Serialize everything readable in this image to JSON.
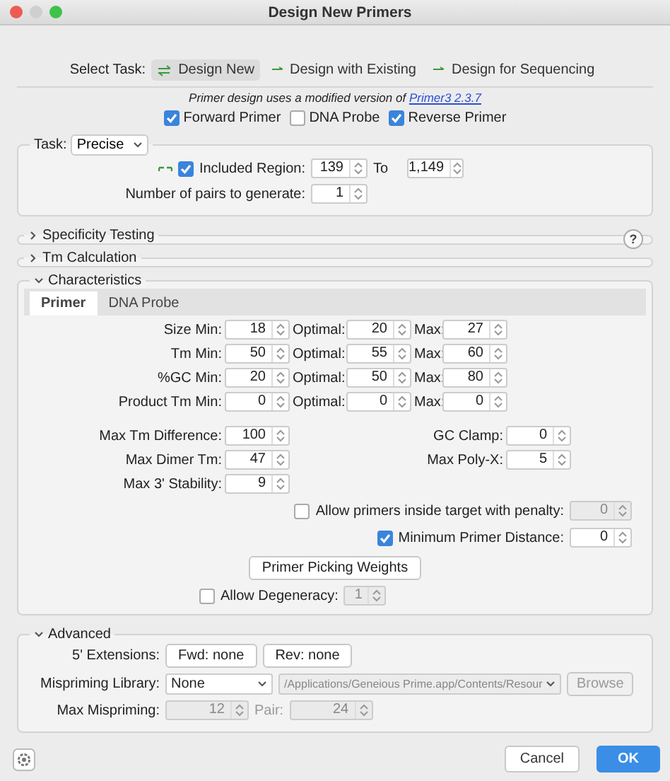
{
  "window": {
    "title": "Design New Primers"
  },
  "select_task": {
    "label": "Select Task:",
    "options": [
      {
        "label": "Design New",
        "selected": true
      },
      {
        "label": "Design with Existing",
        "selected": false
      },
      {
        "label": "Design for Sequencing",
        "selected": false
      }
    ]
  },
  "note": {
    "text": "Primer design uses a modified version of ",
    "link": "Primer3 2.3.7"
  },
  "primer_types": [
    {
      "label": "Forward Primer",
      "checked": true
    },
    {
      "label": "DNA Probe",
      "checked": false
    },
    {
      "label": "Reverse Primer",
      "checked": true
    }
  ],
  "task": {
    "label": "Task:",
    "value": "Precise",
    "included_region": {
      "checked": true,
      "label": "Included Region:",
      "from": "139",
      "to_label": "To",
      "to": "1,149"
    },
    "pairs": {
      "label": "Number of pairs to generate:",
      "value": "1"
    }
  },
  "collapsed_sections": [
    {
      "title": "Specificity Testing",
      "expanded": false,
      "help": "?"
    },
    {
      "title": "Tm Calculation",
      "expanded": false
    }
  ],
  "characteristics": {
    "title": "Characteristics",
    "expanded": true,
    "tabs": [
      {
        "label": "Primer",
        "selected": true
      },
      {
        "label": "DNA Probe",
        "selected": false
      }
    ],
    "ranges": [
      {
        "label": "Size Min:",
        "min": "18",
        "optimal_label": "Optimal:",
        "optimal": "20",
        "max_label": "Max:",
        "max": "27"
      },
      {
        "label": "Tm Min:",
        "min": "50",
        "optimal_label": "Optimal:",
        "optimal": "55",
        "max_label": "Max:",
        "max": "60"
      },
      {
        "label": "%GC Min:",
        "min": "20",
        "optimal_label": "Optimal:",
        "optimal": "50",
        "max_label": "Max:",
        "max": "80"
      },
      {
        "label": "Product Tm Min:",
        "min": "0",
        "optimal_label": "Optimal:",
        "optimal": "0",
        "max_label": "Max:",
        "max": "0"
      }
    ],
    "left_fields": [
      {
        "label": "Max Tm Difference:",
        "value": "100"
      },
      {
        "label": "Max Dimer Tm:",
        "value": "47"
      },
      {
        "label": "Max 3' Stability:",
        "value": "9"
      }
    ],
    "right_fields": [
      {
        "label": "GC Clamp:",
        "value": "0"
      },
      {
        "label": "Max Poly-X:",
        "value": "5"
      }
    ],
    "options": [
      {
        "label": "Allow primers inside target with penalty:",
        "checked": false,
        "value": "0",
        "disabled": true
      },
      {
        "label": "Minimum Primer Distance:",
        "checked": true,
        "value": "0",
        "disabled": false
      }
    ],
    "weights_button": "Primer Picking Weights",
    "degeneracy": {
      "label": "Allow Degeneracy:",
      "checked": false,
      "value": "1",
      "disabled": true
    }
  },
  "advanced": {
    "title": "Advanced",
    "expanded": true,
    "extensions": {
      "label": "5' Extensions:",
      "buttons": [
        "Fwd: none",
        "Rev: none"
      ]
    },
    "mispriming": {
      "label": "Mispriming Library:",
      "library": "None",
      "path": "/Applications/Geneious Prime.app/Contents/Resour",
      "path_disabled": true,
      "browse": "Browse",
      "browse_disabled": true
    },
    "max_mispriming": {
      "label": "Max Mispriming:",
      "value": "12",
      "pair_label": "Pair:",
      "pair": "24",
      "disabled": true
    }
  },
  "footer": {
    "buttons": [
      {
        "label": "Cancel",
        "kind": "secondary"
      },
      {
        "label": "OK",
        "kind": "primary"
      }
    ]
  }
}
